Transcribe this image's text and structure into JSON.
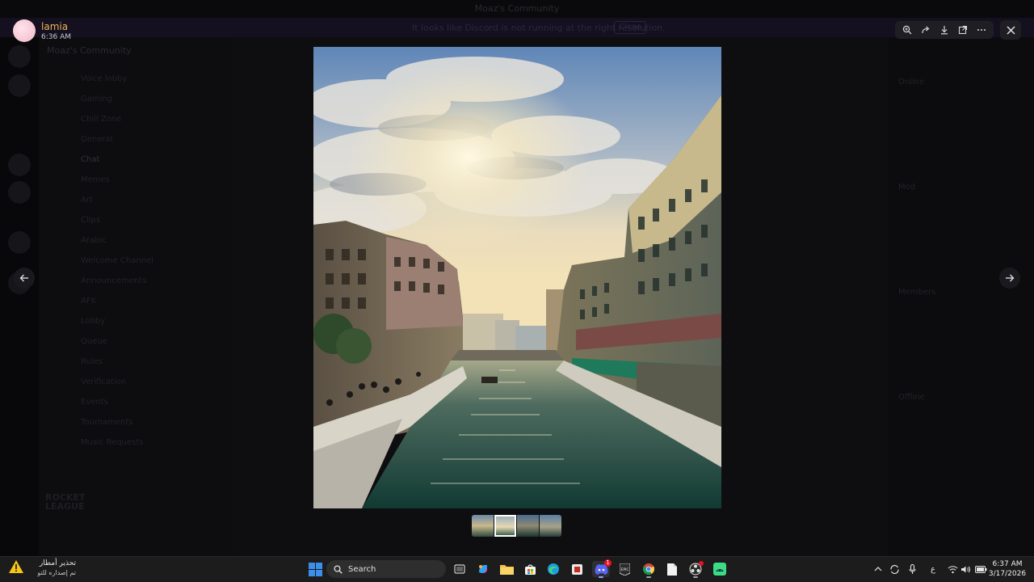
{
  "background_app": {
    "window_title": "Moaz's Community",
    "banner_text": "It looks like Discord is not running at the right resolution.",
    "banner_button": "Close",
    "guild_name": "Moaz's Community",
    "channels": [
      "Voice lobby",
      "Gaming",
      "Chill Zone",
      "General",
      "Chat",
      "Memes",
      "Art",
      "Clips",
      "Arabic",
      "Welcome Channel",
      "Announcements",
      "AFK",
      "Lobby",
      "Queue",
      "Rules",
      "Verification",
      "Events",
      "Tournaments",
      "Music Requests"
    ],
    "active_channel": "Chat",
    "game_logo": "ROCKET LEAGUE",
    "members": [
      "Online",
      "Mod",
      "Members",
      "Offline"
    ]
  },
  "viewer": {
    "author": "lamia",
    "time": "6:36 AM",
    "toolbar": {
      "zoom_icon": "zoom-in-icon",
      "forward_icon": "forward-icon",
      "download_icon": "download-icon",
      "open_icon": "open-external-icon",
      "more_icon": "more-icon"
    },
    "close_icon": "close-icon",
    "prev_icon": "arrow-left-icon",
    "next_icon": "arrow-right-icon",
    "thumbnail_count": 4,
    "active_thumbnail": 1
  },
  "taskbar": {
    "weather_title": "تحذير أمطار",
    "weather_subtitle": "تم إصداره للتو",
    "search_placeholder": "Search",
    "clock_time": "6:37 AM",
    "clock_date": "3/17/2026",
    "language": "ع",
    "discord_badge": "1"
  },
  "colors": {
    "author_name": "#f0b35a",
    "taskbar_bg": "#1c1c1c",
    "discord_blurple": "#5865f2",
    "windows_blue": "#3b8eea"
  }
}
